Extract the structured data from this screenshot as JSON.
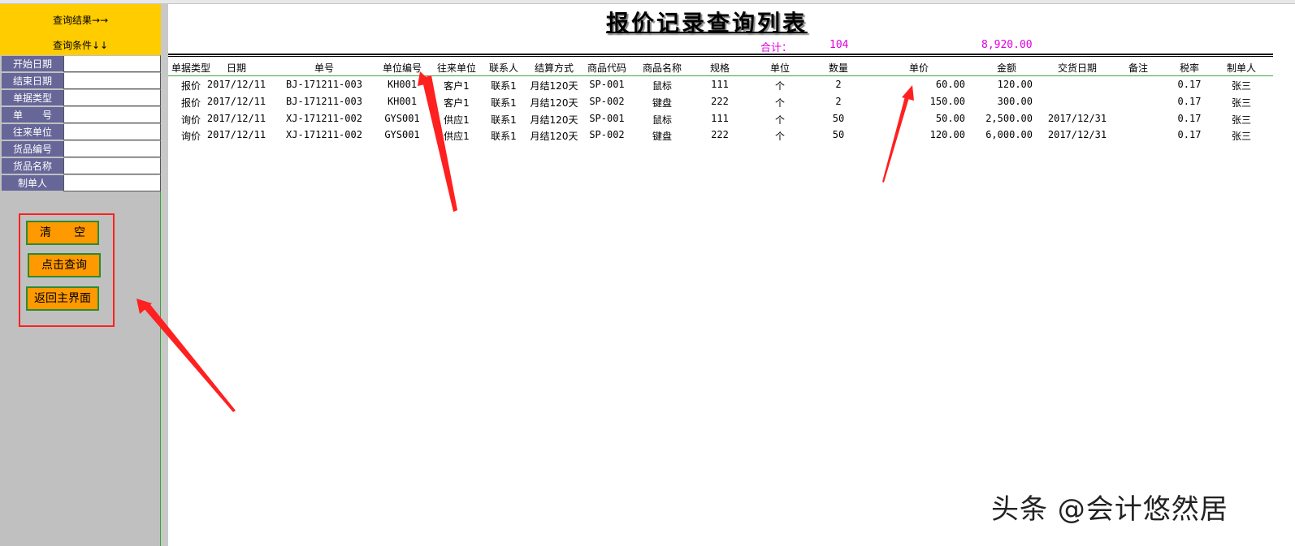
{
  "panel": {
    "result_label": "查询结果→→",
    "condition_label": "查询条件↓↓",
    "fields": [
      {
        "label": "开始日期",
        "value": ""
      },
      {
        "label": "结束日期",
        "value": ""
      },
      {
        "label": "单据类型",
        "value": ""
      },
      {
        "label": "单　　号",
        "value": ""
      },
      {
        "label": "往来单位",
        "value": ""
      },
      {
        "label": "货品编号",
        "value": ""
      },
      {
        "label": "货品名称",
        "value": ""
      },
      {
        "label": "制单人",
        "value": ""
      }
    ],
    "buttons": {
      "clear": "清　　空",
      "query": "点击查询",
      "home": "返回主界面"
    }
  },
  "report": {
    "title": "报价记录查询列表",
    "total_label": "合计：",
    "total_count": "104",
    "total_amount": "8,920.00",
    "columns": [
      "单据类型",
      "日期",
      "单号",
      "单位编号",
      "往来单位",
      "联系人",
      "结算方式",
      "商品代码",
      "商品名称",
      "规格",
      "单位",
      "数量",
      "单价",
      "金额",
      "交货日期",
      "备注",
      "税率",
      "制单人"
    ],
    "rows": [
      [
        "报价",
        "2017/12/11",
        "BJ-171211-003",
        "KH001",
        "客户1",
        "联系1",
        "月结120天",
        "SP-001",
        "鼠标",
        "111",
        "个",
        "2",
        "60.00",
        "120.00",
        "",
        "",
        "0.17",
        "张三"
      ],
      [
        "报价",
        "2017/12/11",
        "BJ-171211-003",
        "KH001",
        "客户1",
        "联系1",
        "月结120天",
        "SP-002",
        "键盘",
        "222",
        "个",
        "2",
        "150.00",
        "300.00",
        "",
        "",
        "0.17",
        "张三"
      ],
      [
        "询价",
        "2017/12/11",
        "XJ-171211-002",
        "GYS001",
        "供应1",
        "联系1",
        "月结120天",
        "SP-001",
        "鼠标",
        "111",
        "个",
        "50",
        "50.00",
        "2,500.00",
        "2017/12/31",
        "",
        "0.17",
        "张三"
      ],
      [
        "询价",
        "2017/12/11",
        "XJ-171211-002",
        "GYS001",
        "供应1",
        "联系1",
        "月结120天",
        "SP-002",
        "键盘",
        "222",
        "个",
        "50",
        "120.00",
        "6,000.00",
        "2017/12/31",
        "",
        "0.17",
        "张三"
      ]
    ]
  },
  "watermark": "头条 @会计悠然居",
  "colors": {
    "yellow": "#ffcc00",
    "label_bg": "#666699",
    "button_bg": "#ff9900",
    "button_border": "#2e8b2e",
    "annotation_red": "#ff2020",
    "total_text": "#e000e0"
  }
}
